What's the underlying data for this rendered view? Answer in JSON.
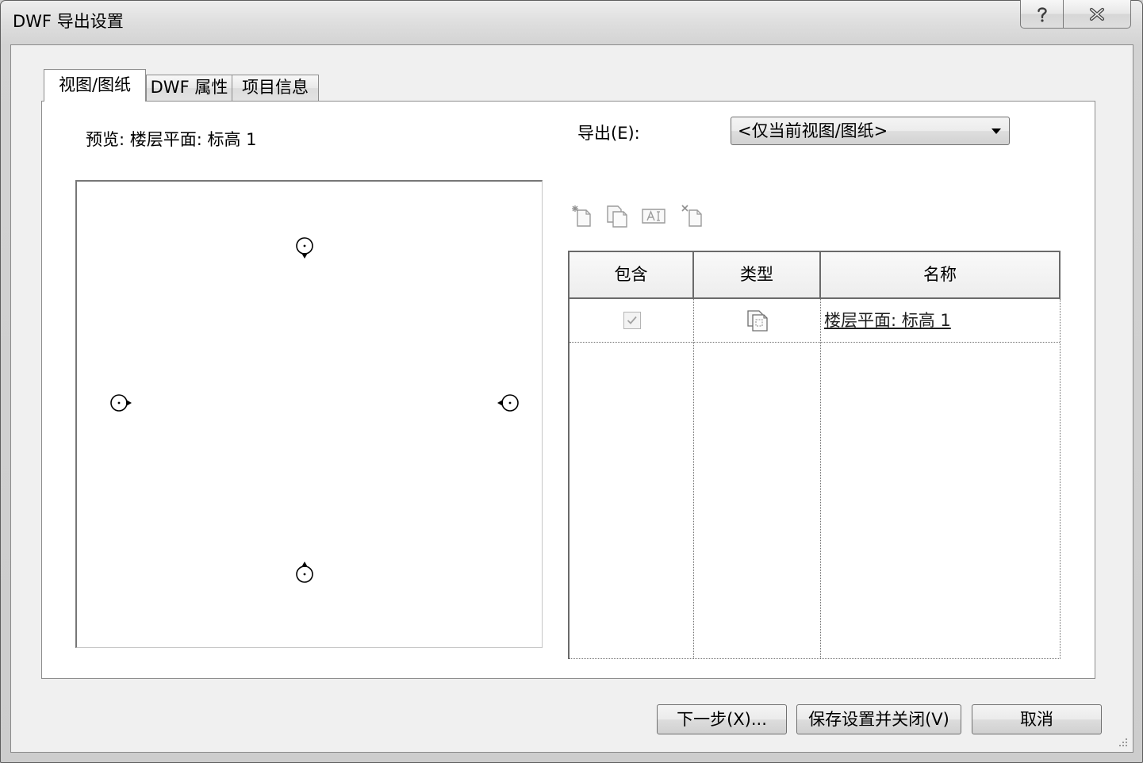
{
  "window": {
    "title": "DWF 导出设置"
  },
  "icons": {
    "help": "help-icon",
    "close": "close-icon",
    "dropdown_arrow": "chevron-down-icon",
    "resize_grip": "resize-grip-icon"
  },
  "tabs": [
    {
      "label": "视图/图纸",
      "active": true
    },
    {
      "label": "DWF 属性",
      "active": false
    },
    {
      "label": "项目信息",
      "active": false
    }
  ],
  "preview": {
    "label": "预览: 楼层平面: 标高 1",
    "markers": [
      "elevation-marker-icon",
      "elevation-marker-icon",
      "elevation-marker-icon",
      "elevation-marker-icon"
    ]
  },
  "export": {
    "label": "导出(E):",
    "selected": "<仅当前视图/图纸>"
  },
  "toolbar": [
    {
      "icon": "new-set-icon",
      "enabled": false
    },
    {
      "icon": "duplicate-set-icon",
      "enabled": false
    },
    {
      "icon": "rename-set-icon",
      "enabled": false
    },
    {
      "icon": "delete-set-icon",
      "enabled": false
    }
  ],
  "table": {
    "columns": [
      "包含",
      "类型",
      "名称"
    ],
    "rows": [
      {
        "include": true,
        "include_enabled": false,
        "type_icon": "floor-plan-view-icon",
        "name": "楼层平面: 标高 1"
      }
    ]
  },
  "buttons": {
    "next": "下一步(X)...",
    "save_close": "保存设置并关闭(V)",
    "cancel": "取消"
  }
}
